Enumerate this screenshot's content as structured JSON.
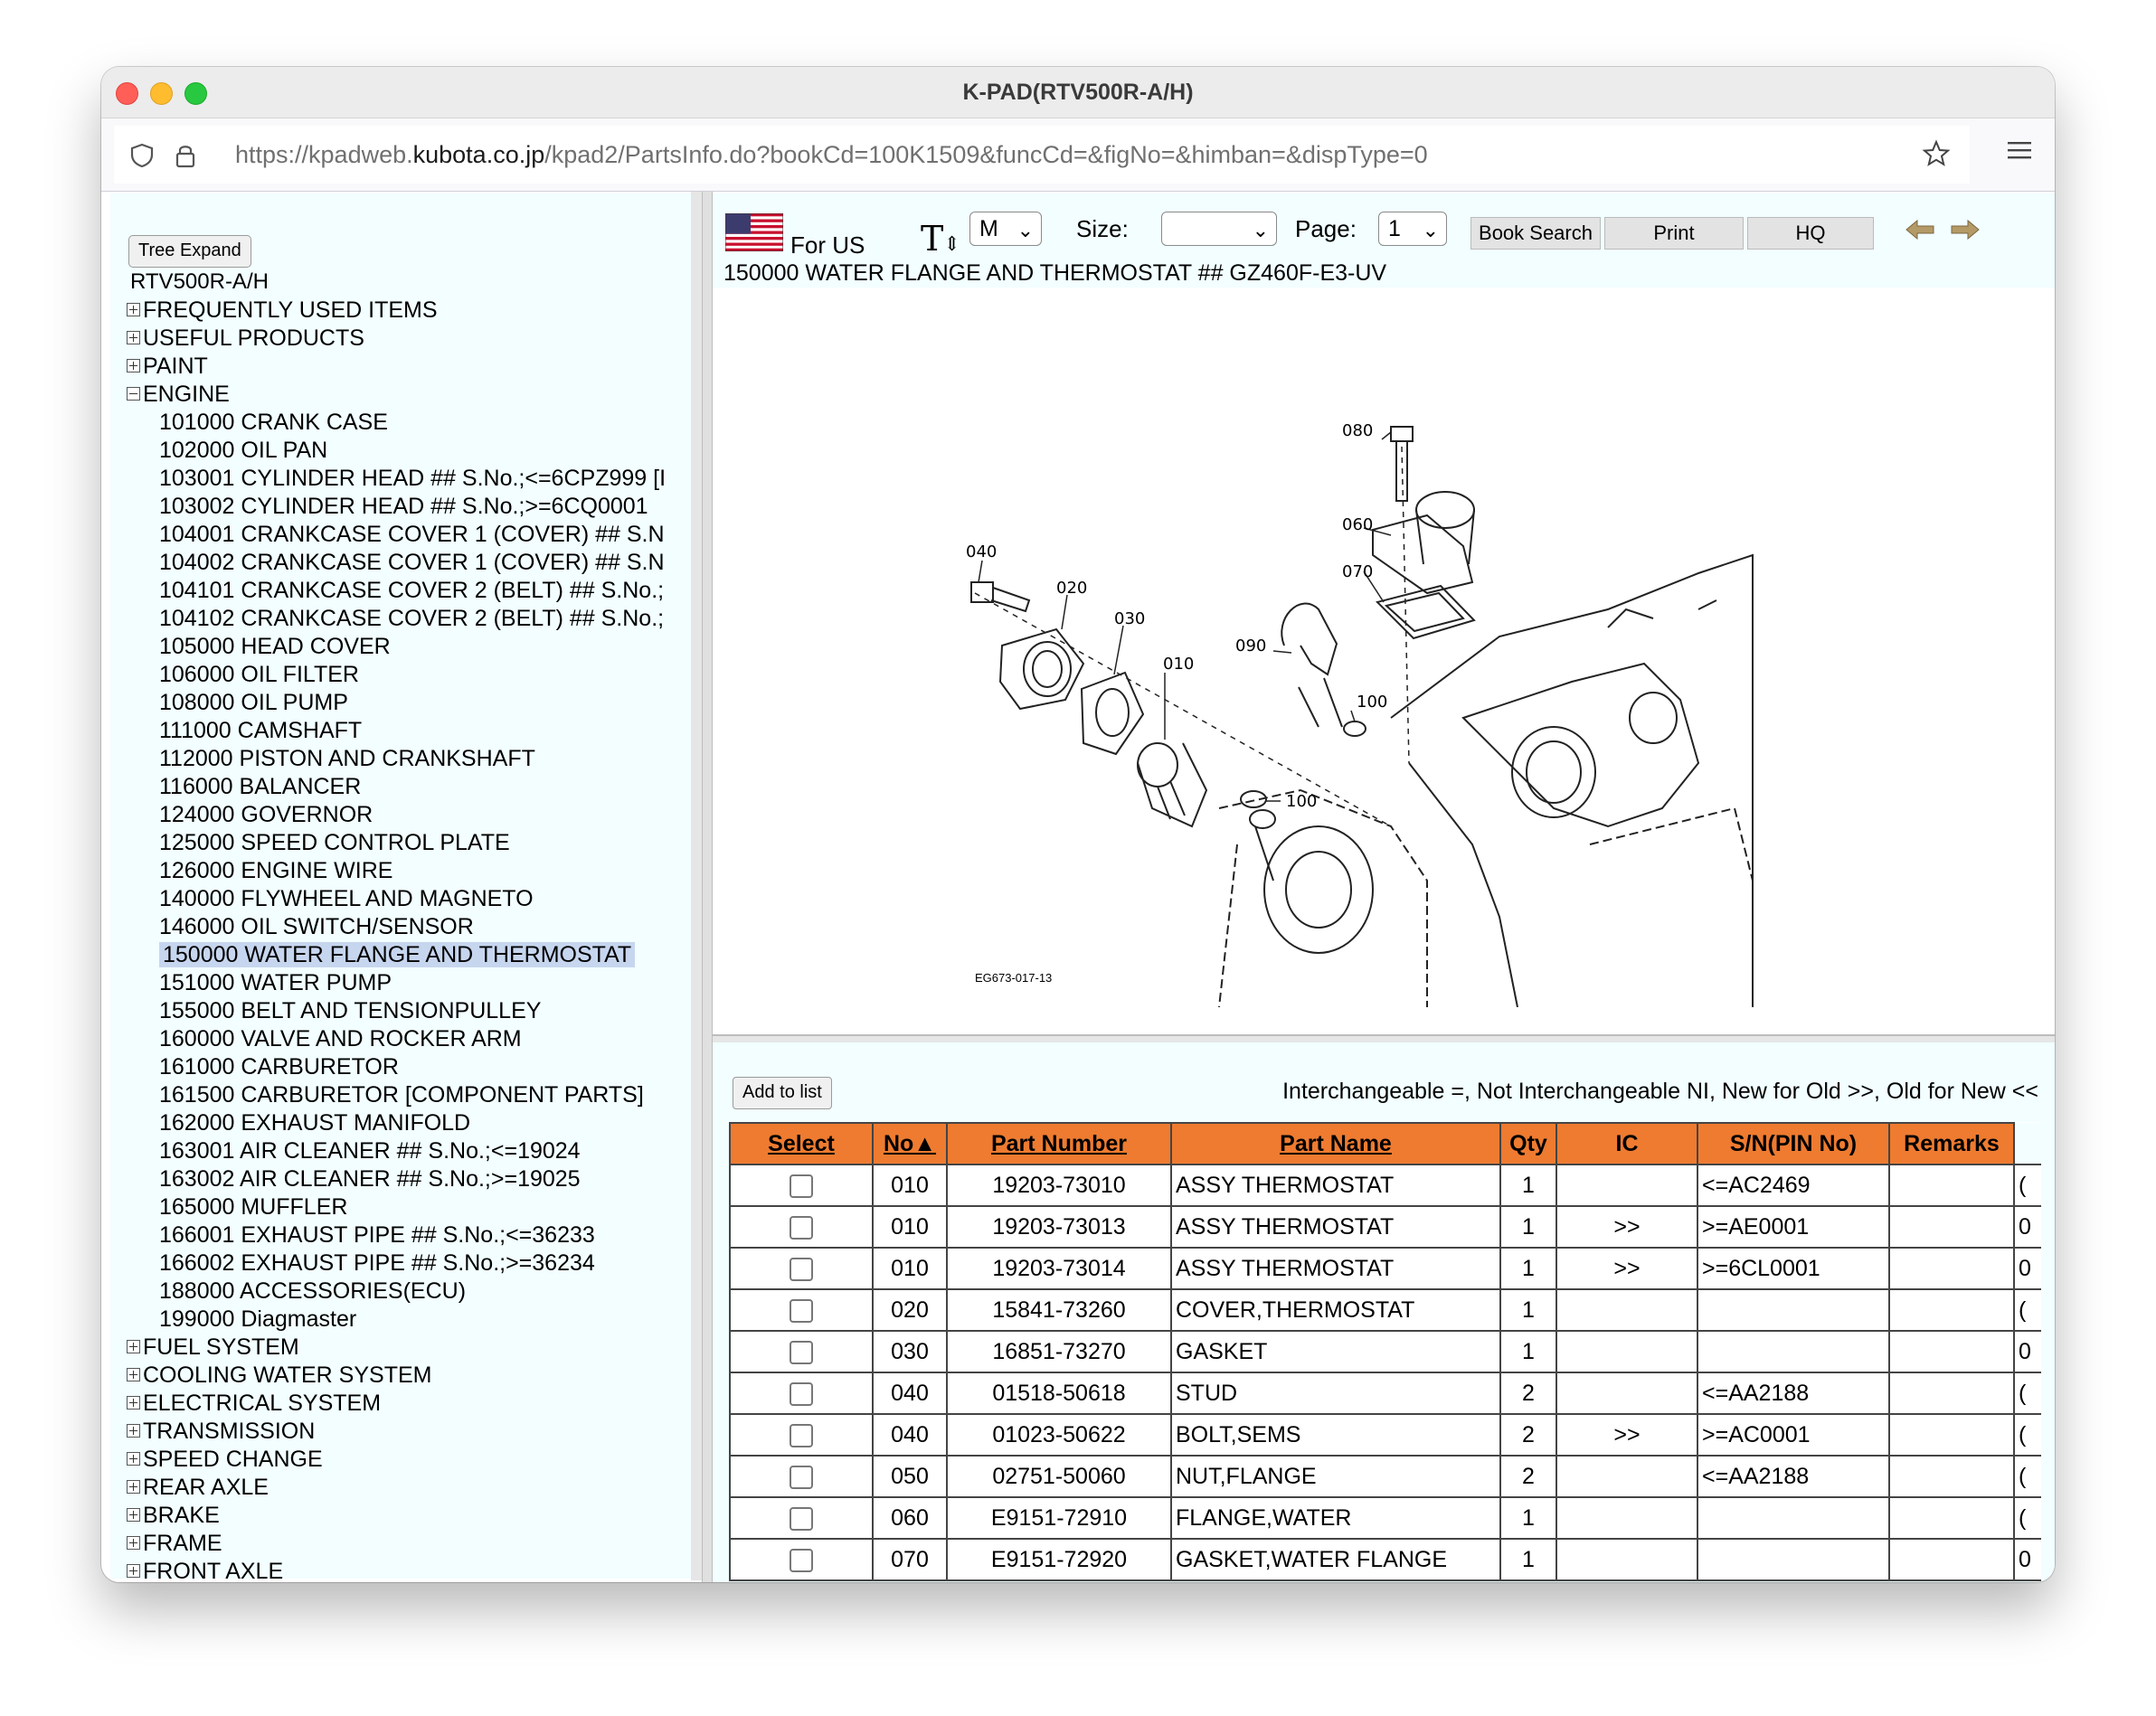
{
  "window": {
    "title": "K-PAD(RTV500R-A/H)"
  },
  "urlbar": {
    "url_prefix": "https://kpadweb.",
    "url_host": "kubota.co.jp",
    "url_path": "/kpad2/PartsInfo.do?bookCd=100K1509&funcCd=&figNo=&himban=&dispType=0"
  },
  "tree": {
    "expand_button": "Tree Expand",
    "root": "RTV500R-A/H",
    "items": [
      {
        "label": "FREQUENTLY USED ITEMS",
        "type": "plus"
      },
      {
        "label": "USEFUL PRODUCTS",
        "type": "plus"
      },
      {
        "label": "PAINT",
        "type": "plus"
      },
      {
        "label": "ENGINE",
        "type": "minus"
      },
      {
        "label": "101000 CRANK CASE",
        "type": "child"
      },
      {
        "label": "102000 OIL PAN",
        "type": "child"
      },
      {
        "label": "103001 CYLINDER HEAD ## S.No.;<=6CPZ999 [I",
        "type": "child"
      },
      {
        "label": "103002 CYLINDER HEAD ## S.No.;>=6CQ0001",
        "type": "child"
      },
      {
        "label": "104001 CRANKCASE COVER 1 (COVER) ## S.N",
        "type": "child"
      },
      {
        "label": "104002 CRANKCASE COVER 1 (COVER) ## S.N",
        "type": "child"
      },
      {
        "label": "104101 CRANKCASE COVER 2 (BELT) ## S.No.;",
        "type": "child"
      },
      {
        "label": "104102 CRANKCASE COVER 2 (BELT) ## S.No.;",
        "type": "child"
      },
      {
        "label": "105000 HEAD COVER",
        "type": "child"
      },
      {
        "label": "106000 OIL FILTER",
        "type": "child"
      },
      {
        "label": "108000 OIL PUMP",
        "type": "child"
      },
      {
        "label": "111000 CAMSHAFT",
        "type": "child"
      },
      {
        "label": "112000 PISTON AND CRANKSHAFT",
        "type": "child"
      },
      {
        "label": "116000 BALANCER",
        "type": "child"
      },
      {
        "label": "124000 GOVERNOR",
        "type": "child"
      },
      {
        "label": "125000 SPEED CONTROL PLATE",
        "type": "child"
      },
      {
        "label": "126000 ENGINE WIRE",
        "type": "child"
      },
      {
        "label": "140000 FLYWHEEL AND MAGNETO",
        "type": "child"
      },
      {
        "label": "146000 OIL SWITCH/SENSOR",
        "type": "child"
      },
      {
        "label": "150000 WATER FLANGE AND THERMOSTAT",
        "type": "child",
        "selected": true
      },
      {
        "label": "151000 WATER PUMP",
        "type": "child"
      },
      {
        "label": "155000 BELT AND TENSIONPULLEY",
        "type": "child"
      },
      {
        "label": "160000 VALVE AND ROCKER ARM",
        "type": "child"
      },
      {
        "label": "161000 CARBURETOR",
        "type": "child"
      },
      {
        "label": "161500 CARBURETOR [COMPONENT PARTS]",
        "type": "child"
      },
      {
        "label": "162000 EXHAUST MANIFOLD",
        "type": "child"
      },
      {
        "label": "163001 AIR CLEANER ## S.No.;<=19024",
        "type": "child"
      },
      {
        "label": "163002 AIR CLEANER ## S.No.;>=19025",
        "type": "child"
      },
      {
        "label": "165000 MUFFLER",
        "type": "child"
      },
      {
        "label": "166001 EXHAUST PIPE ## S.No.;<=36233",
        "type": "child"
      },
      {
        "label": "166002 EXHAUST PIPE ## S.No.;>=36234",
        "type": "child"
      },
      {
        "label": "188000 ACCESSORIES(ECU)",
        "type": "child"
      },
      {
        "label": "199000 Diagmaster",
        "type": "child"
      },
      {
        "label": "FUEL SYSTEM",
        "type": "plus"
      },
      {
        "label": "COOLING WATER SYSTEM",
        "type": "plus"
      },
      {
        "label": "ELECTRICAL SYSTEM",
        "type": "plus"
      },
      {
        "label": "TRANSMISSION",
        "type": "plus"
      },
      {
        "label": "SPEED CHANGE",
        "type": "plus"
      },
      {
        "label": "REAR AXLE",
        "type": "plus"
      },
      {
        "label": "BRAKE",
        "type": "plus"
      },
      {
        "label": "FRAME",
        "type": "plus"
      },
      {
        "label": "FRONT AXLE",
        "type": "plus"
      }
    ]
  },
  "toolbar": {
    "region": "For US",
    "font_size": "M",
    "size_label": "Size:",
    "size_value": "",
    "page_label": "Page:",
    "page_value": "1",
    "book_search": "Book Search",
    "print": "Print",
    "hq": "HQ"
  },
  "figure": {
    "title": "150000 WATER FLANGE AND THERMOSTAT ## GZ460F-E3-UV",
    "code": "EG673-017-13",
    "callouts": [
      "080",
      "060",
      "070",
      "040",
      "020",
      "030",
      "010",
      "090",
      "100",
      "100"
    ]
  },
  "parts": {
    "add_button": "Add to list",
    "legend": "Interchangeable =, Not Interchangeable NI, New for Old >>, Old for New <<",
    "headers": [
      "Select",
      "No▲",
      "Part Number",
      "Part Name",
      "Qty",
      "IC",
      "S/N(PIN No)",
      "Remarks"
    ],
    "rows": [
      {
        "no": "010",
        "part_number": "19203-73010",
        "part_name": "ASSY THERMOSTAT",
        "qty": "1",
        "ic": "",
        "sn": "<=AC2469",
        "remarks": "",
        "cut": "("
      },
      {
        "no": "010",
        "part_number": "19203-73013",
        "part_name": "ASSY THERMOSTAT",
        "qty": "1",
        "ic": ">>",
        "sn": ">=AE0001",
        "remarks": "",
        "cut": "0"
      },
      {
        "no": "010",
        "part_number": "19203-73014",
        "part_name": "ASSY THERMOSTAT",
        "qty": "1",
        "ic": ">>",
        "sn": ">=6CL0001",
        "remarks": "",
        "cut": "0"
      },
      {
        "no": "020",
        "part_number": "15841-73260",
        "part_name": "COVER,THERMOSTAT",
        "qty": "1",
        "ic": "",
        "sn": "",
        "remarks": "",
        "cut": "("
      },
      {
        "no": "030",
        "part_number": "16851-73270",
        "part_name": "GASKET",
        "qty": "1",
        "ic": "",
        "sn": "",
        "remarks": "",
        "cut": "0"
      },
      {
        "no": "040",
        "part_number": "01518-50618",
        "part_name": "STUD",
        "qty": "2",
        "ic": "",
        "sn": "<=AA2188",
        "remarks": "",
        "cut": "("
      },
      {
        "no": "040",
        "part_number": "01023-50622",
        "part_name": "BOLT,SEMS",
        "qty": "2",
        "ic": ">>",
        "sn": ">=AC0001",
        "remarks": "",
        "cut": "("
      },
      {
        "no": "050",
        "part_number": "02751-50060",
        "part_name": "NUT,FLANGE",
        "qty": "2",
        "ic": "",
        "sn": "<=AA2188",
        "remarks": "",
        "cut": "("
      },
      {
        "no": "060",
        "part_number": "E9151-72910",
        "part_name": "FLANGE,WATER",
        "qty": "1",
        "ic": "",
        "sn": "",
        "remarks": "",
        "cut": "("
      },
      {
        "no": "070",
        "part_number": "E9151-72920",
        "part_name": "GASKET,WATER FLANGE",
        "qty": "1",
        "ic": "",
        "sn": "",
        "remarks": "",
        "cut": "0"
      }
    ]
  }
}
